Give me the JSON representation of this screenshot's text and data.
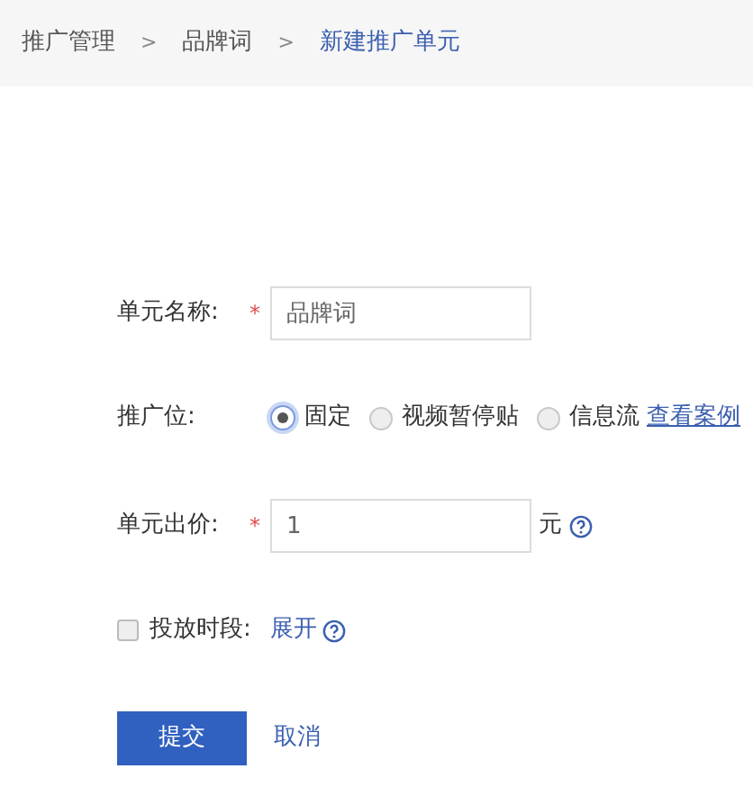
{
  "breadcrumb": [
    {
      "label": "推广管理",
      "current": false
    },
    {
      "label": "品牌词",
      "current": false
    },
    {
      "label": "新建推广单元",
      "current": true
    }
  ],
  "breadcrumb_separator": ">",
  "required_mark": "*",
  "unit_name": {
    "label": "单元名称:",
    "required": true,
    "value": "品牌词"
  },
  "placement": {
    "label": "推广位:",
    "options": [
      {
        "label": "固定",
        "selected": true
      },
      {
        "label": "视频暂停贴",
        "selected": false
      },
      {
        "label": "信息流",
        "selected": false
      }
    ],
    "link": "查看案例"
  },
  "bid": {
    "label": "单元出价:",
    "required": true,
    "value": "1",
    "unit": "元"
  },
  "schedule": {
    "label": "投放时段:",
    "checked": false,
    "link": "展开"
  },
  "buttons": {
    "submit": "提交",
    "cancel": "取消"
  }
}
